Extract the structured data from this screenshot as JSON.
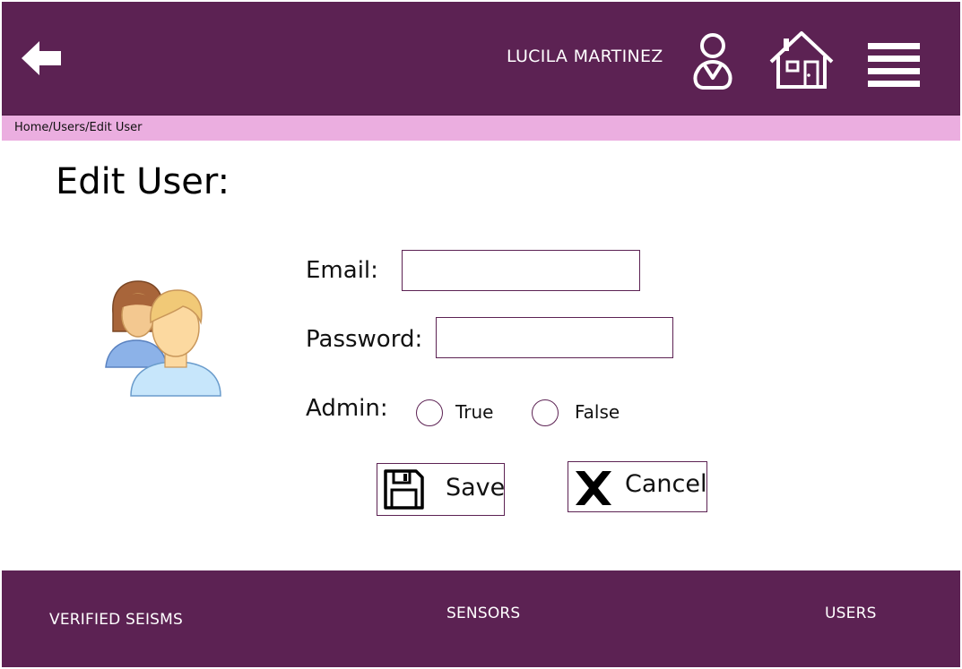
{
  "header": {
    "user_name": "LUCILA MARTINEZ",
    "back_icon": "arrow-left-icon",
    "user_icon": "user-icon",
    "home_icon": "home-icon",
    "menu_icon": "hamburger-menu-icon",
    "background": "#5c2253"
  },
  "breadcrumb": {
    "text": "Home/Users/Edit User",
    "background": "#ebaee0"
  },
  "page": {
    "title": "Edit User:",
    "illustration": "users-group-icon"
  },
  "form": {
    "email_label": "Email:",
    "email_value": "",
    "password_label": "Password:",
    "password_value": "",
    "admin_label": "Admin:",
    "admin_options": [
      "True",
      "False"
    ],
    "admin_selected": null
  },
  "actions": {
    "save_label": "Save",
    "save_icon": "floppy-disk-icon",
    "cancel_label": "Cancel",
    "cancel_icon": "x-mark-icon"
  },
  "footer": {
    "items": [
      "VERIFIED SEISMS",
      "SENSORS",
      "USERS"
    ],
    "background": "#5c2253"
  }
}
